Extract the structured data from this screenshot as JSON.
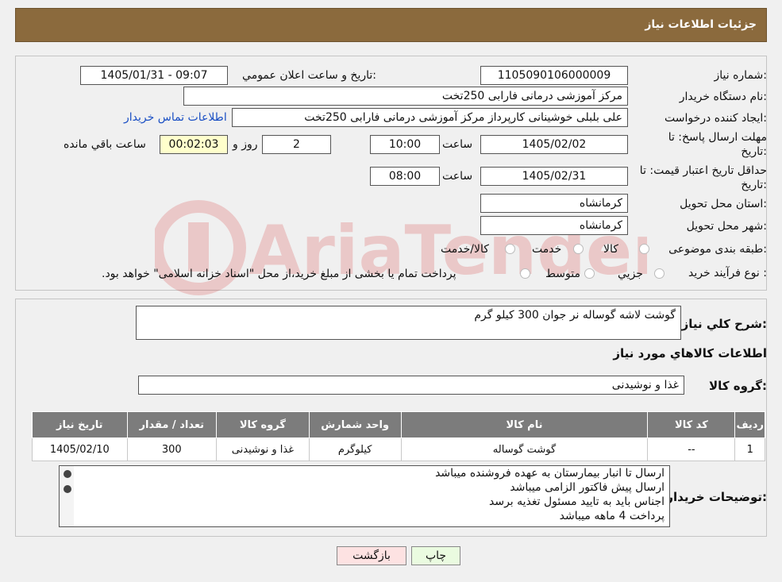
{
  "header": {
    "title": "جزئیات اطلاعات نیاز"
  },
  "form": {
    "need_number_label": "شماره نیاز:",
    "need_number": "1105090106000009",
    "announce_label": "تاریخ و ساعت اعلان عمومي:",
    "announce_value": "1405/01/31 - 09:07",
    "buyer_org_label": "نام دستگاه خريدار:",
    "buyer_org": "مرکز آموزشی  درمانی فارابی 250تخت",
    "requester_label": "ايجاد کننده درخواست:",
    "requester": "علی بلبلی خوشینانی کارپرداز مرکز آموزشی  درمانی فارابی 250تخت",
    "contact_link": "اطلاعات تماس خريدار",
    "deadline_label_1": "مهلت ارسال پاسخ: تا",
    "deadline_label_2": "تاريخ:",
    "deadline_date": "1405/02/02",
    "time_label": "ساعت",
    "deadline_time": "10:00",
    "days_value": "2",
    "days_label": "روز و",
    "remaining_value": "00:02:03",
    "remaining_label": "ساعت باقي مانده",
    "validity_label_1": "حداقل تاريخ اعتبار قيمت: تا",
    "validity_label_2": "تاريخ:",
    "validity_date": "1405/02/31",
    "validity_time": "08:00",
    "province_label": "استان محل تحويل:",
    "province": "کرمانشاه",
    "city_label": "شهر محل تحويل:",
    "city": "کرمانشاه",
    "category_label": "طبقه بندی موضوعی:",
    "category_options": [
      "کالا",
      "خدمت",
      "کالا/خدمت"
    ],
    "process_label": "نوع فرآيند خريد :",
    "process_options": [
      "جزيي",
      "متوسط"
    ],
    "process_note": "پرداخت تمام يا بخشی از مبلغ خريد،از محل \"اسناد خزانه اسلامی\" خواهد بود."
  },
  "summary": {
    "desc_label": "شرح کلي نياز:",
    "desc_value": "گوشت لاشه گوساله نر جوان 300 کیلو گرم",
    "goods_info_title": "اطلاعات کالاهاي مورد نياز",
    "goods_group_label": "گروه کالا:",
    "goods_group_value": "غذا و نوشیدنی"
  },
  "table": {
    "headers": [
      "رديف",
      "کد کالا",
      "نام کالا",
      "واحد شمارش",
      "گروه کالا",
      "تعداد / مقدار",
      "تاريخ نياز"
    ],
    "rows": [
      [
        "1",
        "--",
        "گوشت گوساله",
        "کیلوگرم",
        "غذا و نوشیدنی",
        "300",
        "1405/02/10"
      ]
    ]
  },
  "notes": {
    "label": "توضيحات خريدار:",
    "lines": [
      "ارسال تا انبار بیمارستان به عهده فروشنده میباشد",
      "ارسال پیش فاکتور الزامی میباشد",
      "اجناس باید به تایید مسئول تغذیه برسد",
      "پرداخت 4 ماهه میباشد"
    ]
  },
  "buttons": {
    "print": "چاپ",
    "back": "بازگشت"
  },
  "watermark": {
    "text": "AriaTender.neT"
  }
}
